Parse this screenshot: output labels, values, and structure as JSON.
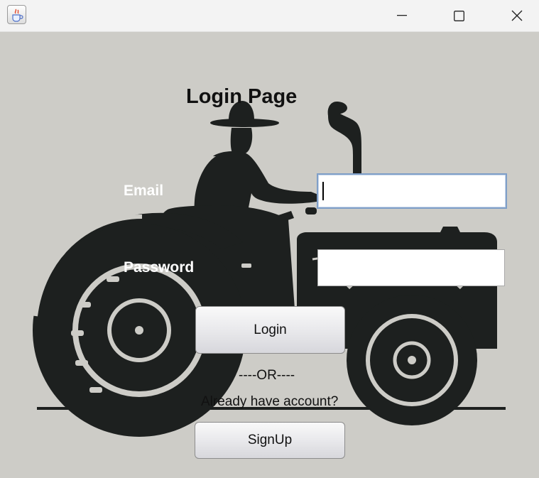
{
  "window": {
    "app_icon": "java-coffee-icon",
    "controls": [
      "minimize-icon",
      "maximize-icon",
      "close-icon"
    ]
  },
  "form": {
    "title": "Login Page",
    "email_label": "Email",
    "password_label": "Password",
    "email_value": "",
    "password_value": "",
    "login_label": "Login",
    "or_text": "----OR----",
    "account_text": "Already have account?",
    "signup_label": "SignUp"
  },
  "background": {
    "image": "tractor-farmer-silhouette",
    "colors": {
      "background": "#cdccc7",
      "silhouette": "#1d201f"
    }
  }
}
